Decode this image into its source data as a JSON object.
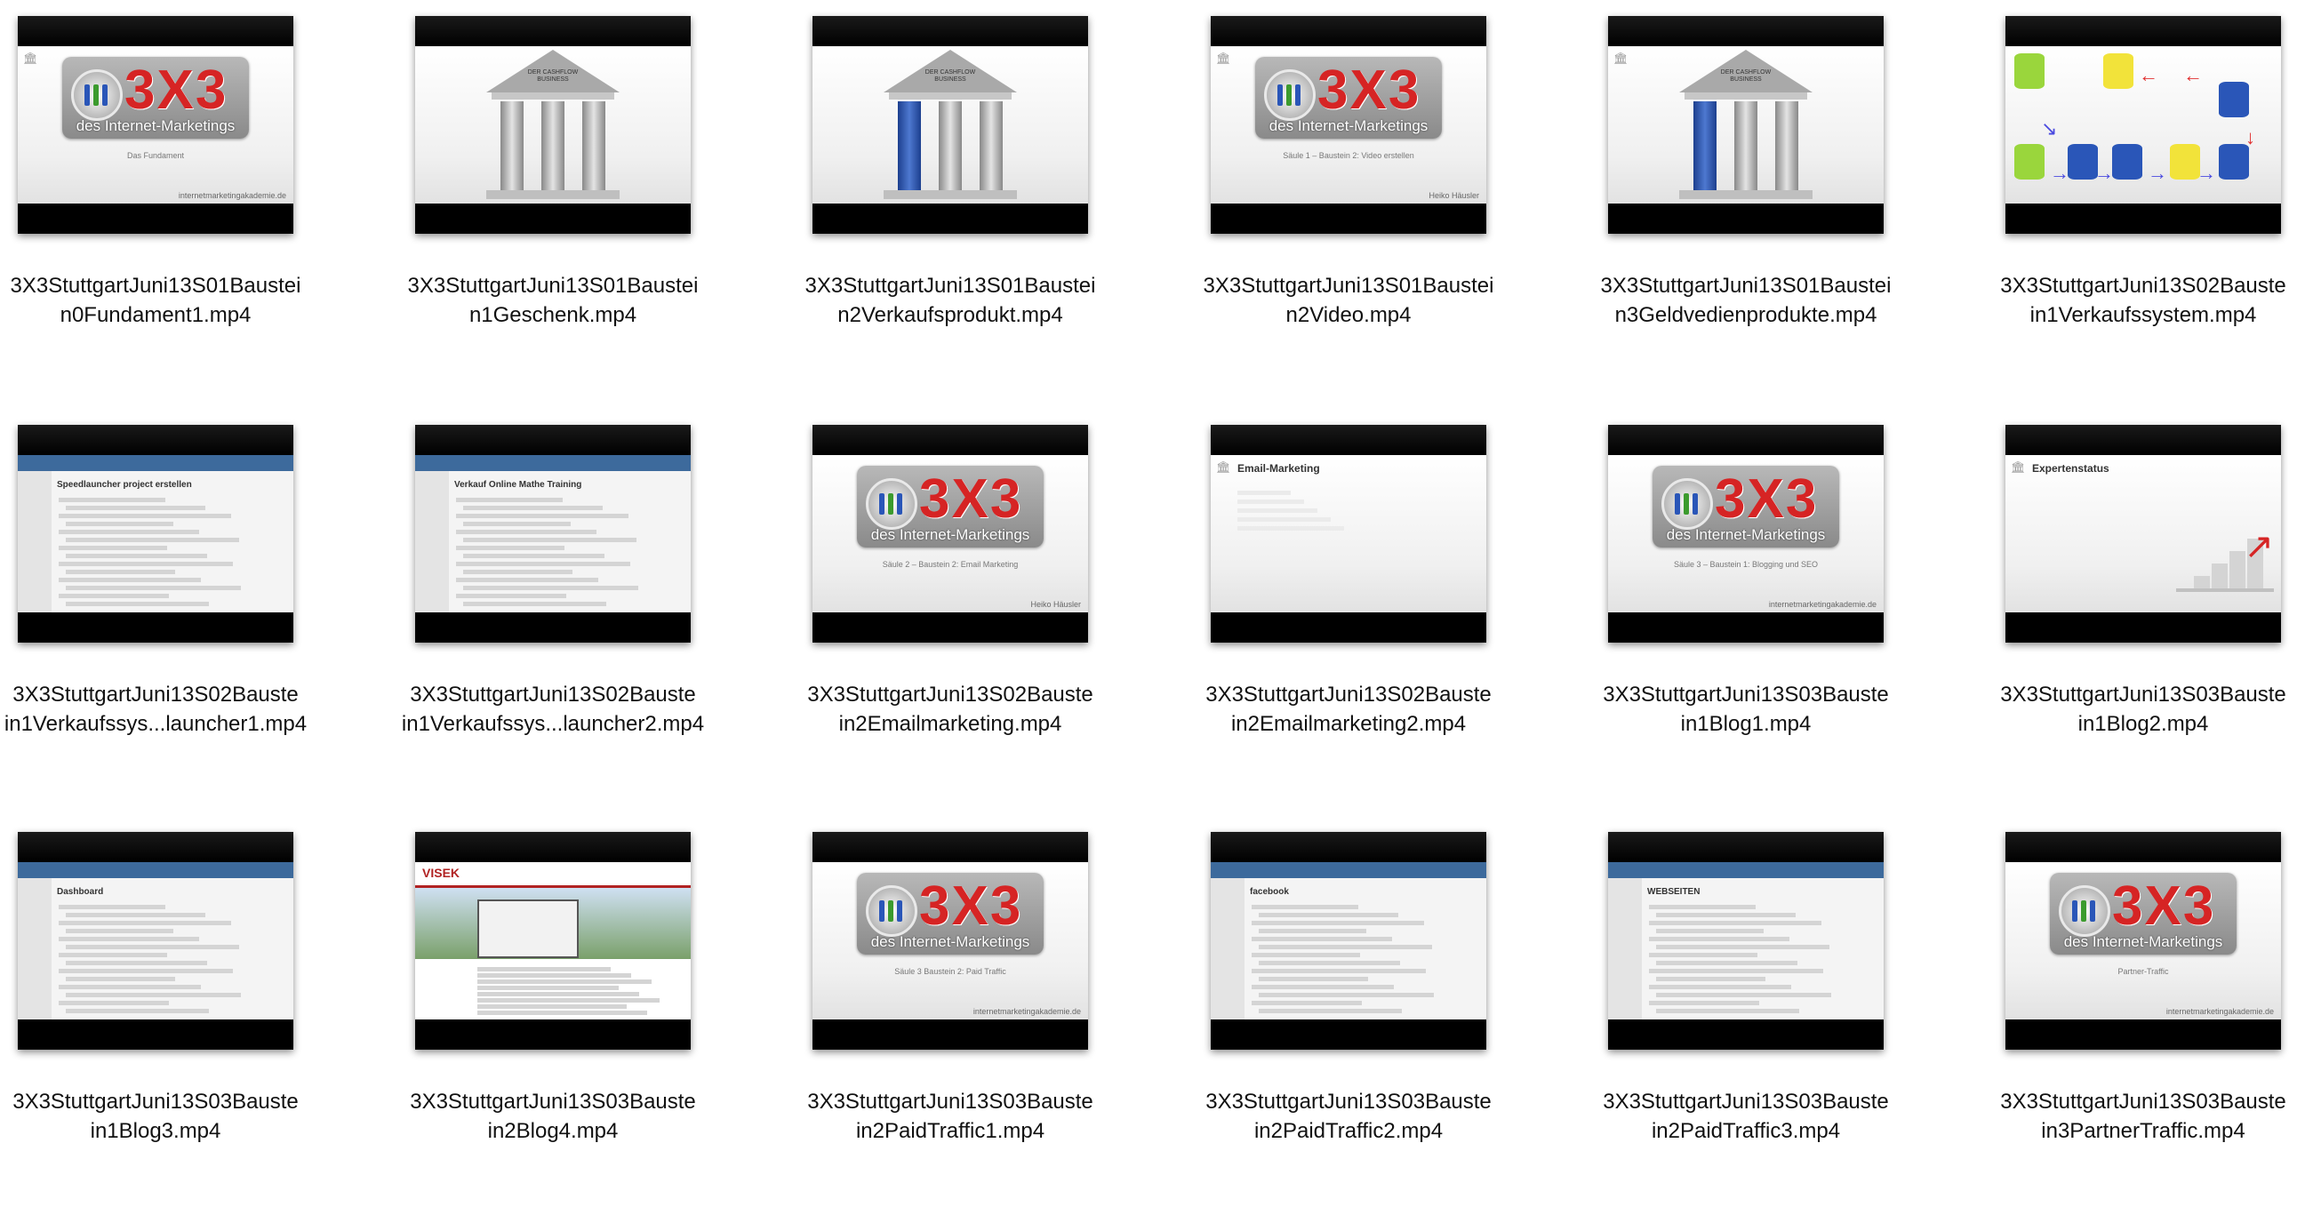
{
  "files": [
    {
      "name": "3X3StuttgartJuni13S01Baustei\nn0Fundament1.mp4",
      "kind": "logo",
      "subtitle": "Das Fundament",
      "url": "internetmarketingakademie.de",
      "corner_icon": true
    },
    {
      "name": "3X3StuttgartJuni13S01Baustei\nn1Geschenk.mp4",
      "kind": "temple",
      "temple_text": "DER CASHFLOW BUSINESS",
      "blue_column": false
    },
    {
      "name": "3X3StuttgartJuni13S01Baustei\nn2Verkaufsprodukt.mp4",
      "kind": "temple",
      "temple_text": "DER CASHFLOW BUSINESS",
      "blue_column": true
    },
    {
      "name": "3X3StuttgartJuni13S01Baustei\nn2Video.mp4",
      "kind": "logo",
      "subtitle": "Säule 1 – Baustein 2: Video erstellen",
      "url": "Heiko Häusler",
      "corner_icon": true
    },
    {
      "name": "3X3StuttgartJuni13S01Baustei\nn3Geldvedienprodukte.mp4",
      "kind": "temple",
      "temple_text": "DER CASHFLOW BUSINESS",
      "blue_column": true,
      "corner_icon": true
    },
    {
      "name": "3X3StuttgartJuni13S02Bauste\nin1Verkaufssystem.mp4",
      "kind": "flow"
    },
    {
      "name": "3X3StuttgartJuni13S02Bauste\nin1Verkaufssys...launcher1.mp4",
      "kind": "screen",
      "screen_title": "Speedlauncher project erstellen"
    },
    {
      "name": "3X3StuttgartJuni13S02Bauste\nin1Verkaufssys...launcher2.mp4",
      "kind": "screen",
      "screen_title": "Verkauf Online Mathe Training"
    },
    {
      "name": "3X3StuttgartJuni13S02Bauste\nin2Emailmarketing.mp4",
      "kind": "logo",
      "subtitle": "Säule 2 – Baustein 2: Email Marketing",
      "url": "Heiko Häusler"
    },
    {
      "name": "3X3StuttgartJuni13S02Bauste\nin2Emailmarketing2.mp4",
      "kind": "slide",
      "slide_title": "Email-Marketing"
    },
    {
      "name": "3X3StuttgartJuni13S03Bauste\nin1Blog1.mp4",
      "kind": "logo",
      "subtitle": "Säule 3 – Baustein 1: Blogging und SEO",
      "url": "internetmarketingakademie.de"
    },
    {
      "name": "3X3StuttgartJuni13S03Bauste\nin1Blog2.mp4",
      "kind": "slide",
      "slide_title": "Expertenstatus"
    },
    {
      "name": "3X3StuttgartJuni13S03Bauste\nin1Blog3.mp4",
      "kind": "screen",
      "screen_title": "Dashboard"
    },
    {
      "name": "3X3StuttgartJuni13S03Bauste\nin2Blog4.mp4",
      "kind": "house",
      "screen_title": "VISEK"
    },
    {
      "name": "3X3StuttgartJuni13S03Bauste\nin2PaidTraffic1.mp4",
      "kind": "logo",
      "subtitle": "Säule 3 Baustein 2: Paid Traffic",
      "url": "internetmarketingakademie.de"
    },
    {
      "name": "3X3StuttgartJuni13S03Bauste\nin2PaidTraffic2.mp4",
      "kind": "screen",
      "screen_title": "facebook"
    },
    {
      "name": "3X3StuttgartJuni13S03Bauste\nin2PaidTraffic3.mp4",
      "kind": "screen",
      "screen_title": "WEBSEITEN"
    },
    {
      "name": "3X3StuttgartJuni13S03Bauste\nin3PartnerTraffic.mp4",
      "kind": "logo",
      "subtitle": "Partner-Traffic",
      "url": "internetmarketingakademie.de"
    }
  ],
  "logo": {
    "big_text": "3X3",
    "tagline": "des Internet-Marketings"
  },
  "colors": {
    "logo_red": "#d62424",
    "column_blue": "#2a56b8",
    "background": "#ffffff"
  }
}
